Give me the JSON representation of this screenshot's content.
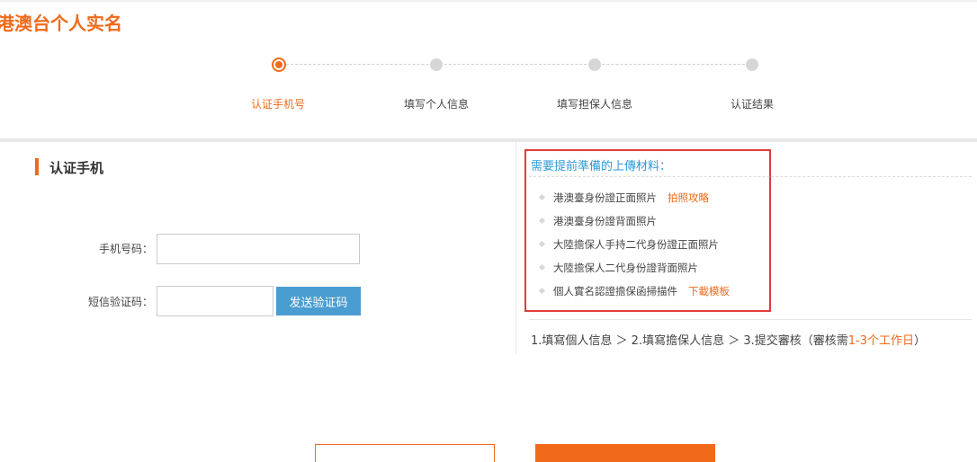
{
  "page": {
    "title": "港澳台个人实名"
  },
  "steps": [
    {
      "label": "认证手机号",
      "active": true
    },
    {
      "label": "填写个人信息",
      "active": false
    },
    {
      "label": "填写担保人信息",
      "active": false
    },
    {
      "label": "认证结果",
      "active": false
    }
  ],
  "verify": {
    "section_title": "认证手机",
    "phone_label": "手机号码：",
    "phone_value": "",
    "sms_label": "短信验证码：",
    "sms_value": "",
    "send_button": "发送验证码"
  },
  "materials": {
    "title": "需要提前準備的上傳材料：",
    "items": [
      {
        "text": "港澳臺身份證正面照片",
        "link": "拍照攻略"
      },
      {
        "text": "港澳臺身份證背面照片",
        "link": ""
      },
      {
        "text": "大陸擔保人手持二代身份證正面照片",
        "link": ""
      },
      {
        "text": "大陸擔保人二代身份證背面照片",
        "link": ""
      },
      {
        "text": "個人實名認證擔保函掃描件",
        "link": "下載模板"
      }
    ]
  },
  "process": {
    "text": "1.填寫個人信息 ＞ 2.填寫擔保人信息 ＞ 3.提交審核（審核需",
    "highlight": "1-3个工作日",
    "suffix": "）"
  },
  "colors": {
    "accent": "#f06a1a",
    "link_blue": "#2d9ad6",
    "button_blue": "#4a9dd0",
    "alert_red": "#e33b3b"
  }
}
